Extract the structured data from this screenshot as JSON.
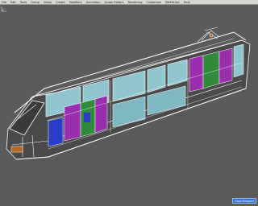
{
  "menubar": {
    "items": [
      "File",
      "Edit",
      "Tools",
      "Group",
      "Views",
      "Create",
      "Modifiers",
      "Animation",
      "Graph Editors",
      "Rendering",
      "Customize",
      "MAXScript",
      "Help"
    ]
  },
  "viewport": {
    "label": "",
    "status_button": "ClearViewport"
  },
  "colors": {
    "viewport_bg": "#5b5b5b",
    "window_glass": "#8fc6cf",
    "door_magenta": "#9a2fae",
    "door_green": "#2f8a3a",
    "door_blue": "#2a3cc8",
    "wireframe": "#ffffff",
    "accent_orange": "#b5651d"
  }
}
